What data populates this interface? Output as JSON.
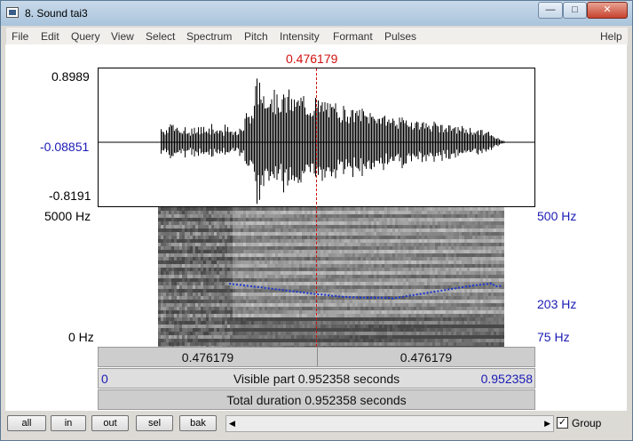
{
  "window": {
    "title": "8. Sound tai3",
    "min_glyph": "—",
    "max_glyph": "□",
    "close_glyph": "✕"
  },
  "menu": {
    "items": [
      "File",
      "Edit",
      "Query",
      "View",
      "Select",
      "Spectrum",
      "Pitch",
      "Intensity",
      "Formant",
      "Pulses"
    ],
    "help": "Help"
  },
  "cursor": {
    "time": "0.476179",
    "fraction": 0.5
  },
  "waveform": {
    "max": "0.8989",
    "zero_value": "-0.08851",
    "min": "-0.8191"
  },
  "spectrogram": {
    "freq_top": "5000 Hz",
    "freq_bottom": "0 Hz",
    "pitch_top": "500 Hz",
    "pitch_mid": "203 Hz",
    "pitch_bottom": "75 Hz"
  },
  "timebar": {
    "left_value": "0.476179",
    "right_value": "0.476179",
    "start": "0",
    "visible_part": "Visible part 0.952358 seconds",
    "end": "0.952358",
    "total_duration": "Total duration 0.952358 seconds"
  },
  "buttons": [
    "all",
    "in",
    "out",
    "sel",
    "bak"
  ],
  "group": {
    "label": "Group",
    "checked": true,
    "check_glyph": "✓"
  },
  "scroll_left": "◀",
  "scroll_right": "▶",
  "colors": {
    "cursor": "#d01010",
    "pitch": "#1a35d0",
    "axis_blue": "#1a1ab5"
  }
}
